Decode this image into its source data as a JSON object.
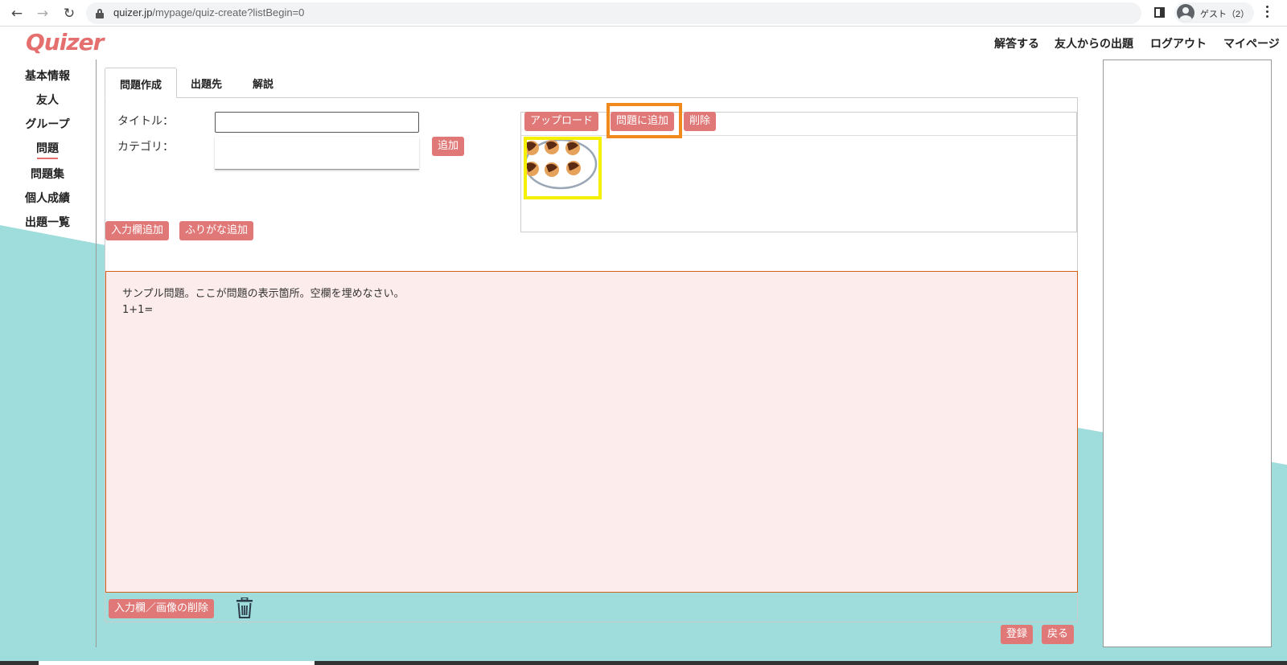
{
  "browser": {
    "url_domain": "quizer.jp",
    "url_path": "/mypage/quiz-create?listBegin=0",
    "profile_label": "ゲスト（2）"
  },
  "header": {
    "logo": "Quizer",
    "nav": [
      "解答する",
      "友人からの出題",
      "ログアウト",
      "マイページ"
    ]
  },
  "sidebar": {
    "items": [
      "基本情報",
      "友人",
      "グループ",
      "問題",
      "問題集",
      "個人成績",
      "出題一覧"
    ],
    "active_index": 3
  },
  "tabs": [
    "問題作成",
    "出題先",
    "解説"
  ],
  "form": {
    "title_label": "タイトル：",
    "title_value": "",
    "category_label": "カテゴリ：",
    "add_category_button": "追加"
  },
  "image_toolbar": {
    "upload_button": "アップロード",
    "add_to_question_button": "問題に追加",
    "delete_button": "削除"
  },
  "field_buttons": {
    "add_input_field": "入力欄追加",
    "add_furigana": "ふりがな追加"
  },
  "question": {
    "line1": "サンプル問題。ここが問題の表示箇所。空欄を埋めなさい。",
    "line2": "1+1="
  },
  "delete_input_image_button": "入力欄／画像の削除",
  "footer": {
    "register_button": "登録",
    "back_button": "戻る"
  },
  "colors": {
    "accent": "#e07878",
    "logo": "#e56f6f",
    "teal_background": "#9fdcdc",
    "question_bg": "#fdecec",
    "highlight_orange": "#f08a1c",
    "highlight_yellow": "#f5f000"
  }
}
